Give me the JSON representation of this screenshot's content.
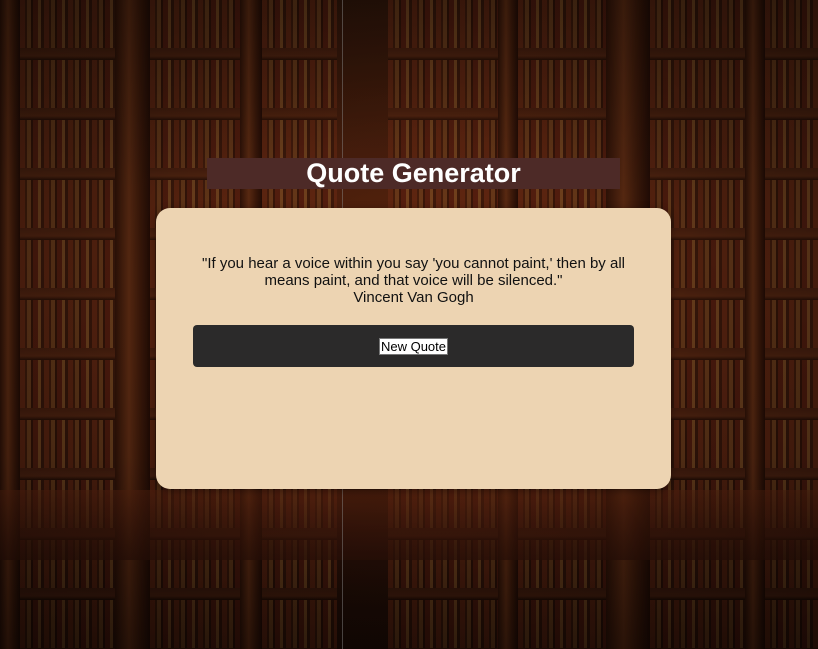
{
  "header": {
    "title": "Quote Generator"
  },
  "quote": {
    "text": "\"If you hear a voice within you say 'you cannot paint,' then by all means paint, and that voice will be silenced.\"",
    "author": "Vincent Van Gogh"
  },
  "actions": {
    "new_quote_label": "New Quote"
  },
  "colors": {
    "title_bar": "#4d2a27",
    "card": "#edd4b2",
    "button_bar": "#2b2a2a"
  }
}
